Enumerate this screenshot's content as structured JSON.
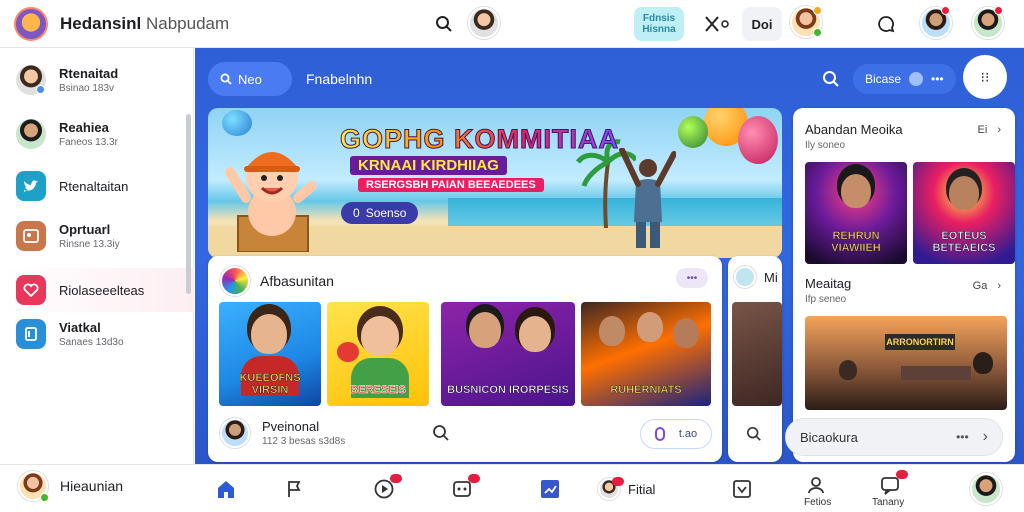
{
  "header": {
    "title_bold": "Hedansinl",
    "title_light": "Nabpudam",
    "promo_chip_line1": "Fdnsis",
    "promo_chip_line2": "Hisnna",
    "chip_label": "Doi"
  },
  "sidebar": {
    "items": [
      {
        "name": "Rtenaitad",
        "sub": "Bsinao 183v"
      },
      {
        "name": "Reahiea",
        "sub": "Faneos 13.3r"
      },
      {
        "name": "Rtenaltaitan",
        "sub": ""
      },
      {
        "name": "Oprtuarl",
        "sub": "Rinsne 13.3iy"
      },
      {
        "name": "Riolaseeelteas",
        "sub": ""
      },
      {
        "name": "Viatkal",
        "sub": "Sanaes 13d3o"
      }
    ]
  },
  "main": {
    "search_label": "Neo",
    "tab_label": "Fnabelnhn",
    "right_pill_label": "Bicase"
  },
  "banner": {
    "title": "GOPHG KOMMITIAA",
    "subtitle1": "KRNAAI KIRDHIIAG",
    "subtitle2": "RSERGSBH PAIAN BEEAEDEES",
    "button_label": "Soenso",
    "button_number": "0"
  },
  "feed_card": {
    "title": "Afbasunitan",
    "thumbs": [
      {
        "caption": "KUEEOFNS VIRSIN"
      },
      {
        "caption": "BERESEIS"
      },
      {
        "caption": "BUSNICON IRORPESIS"
      },
      {
        "caption": "RUHERNIATS"
      }
    ],
    "footer_name": "Pveinonal",
    "footer_sub": "112 3 besas s3d8s",
    "footer_chip": "t.ao"
  },
  "peek_card": {
    "label": "Mi"
  },
  "right_panel": {
    "row1_title": "Abandan Meoika",
    "row1_sub": "Ily soneo",
    "row1_meta": "Ei",
    "neon1_caption": "REHRUN VIAWIIEH",
    "neon2_caption": "EOTEUS BETEAEICS",
    "row2_title": "Meaitag",
    "row2_sub": "Ifp seneo",
    "row2_meta": "Ga",
    "scene_caption": "ARRONORTIRN",
    "footer_label": "Bicaokura"
  },
  "bottom_bar": {
    "profile_label": "Hieaunian",
    "shop_label": "Fitial",
    "label_a": "Fetios",
    "label_b": "Tanany"
  }
}
